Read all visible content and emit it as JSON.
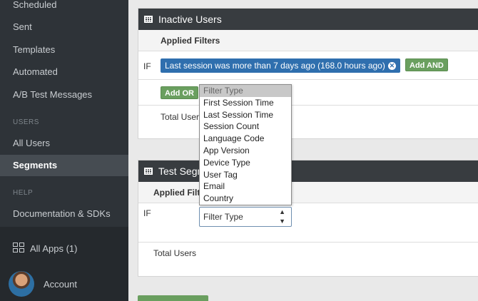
{
  "sidebar": {
    "items": [
      {
        "label": "Scheduled"
      },
      {
        "label": "Sent"
      },
      {
        "label": "Templates"
      },
      {
        "label": "Automated"
      },
      {
        "label": "A/B Test Messages"
      }
    ],
    "users_header": "USERS",
    "users_items": [
      {
        "label": "All Users"
      },
      {
        "label": "Segments"
      }
    ],
    "help_header": "HELP",
    "help_items": [
      {
        "label": "Documentation & SDKs"
      }
    ],
    "all_apps": "All Apps (1)",
    "account": "Account"
  },
  "panel1": {
    "title": "Inactive Users",
    "applied_filters": "Applied Filters",
    "if_label": "IF",
    "filter_chip": "Last session was more than 7 days ago (168.0 hours ago)",
    "add_and": "Add AND",
    "add_or": "Add OR",
    "total_users": "Total Users"
  },
  "panel2": {
    "title": "Test Segm",
    "applied_filters": "Applied Filte",
    "if_label": "IF",
    "total_users": "Total Users"
  },
  "dropdown": {
    "options": [
      "Filter Type",
      "First Session Time",
      "Last Session Time",
      "Session Count",
      "Language Code",
      "App Version",
      "Device Type",
      "User Tag",
      "Email",
      "Country"
    ],
    "selected": "Filter Type"
  },
  "colors": {
    "sidebar_bg": "#2e3338",
    "panel_header_bg": "#383c40",
    "chip_blue": "#2f6fae",
    "button_green": "#6a9f5f"
  }
}
